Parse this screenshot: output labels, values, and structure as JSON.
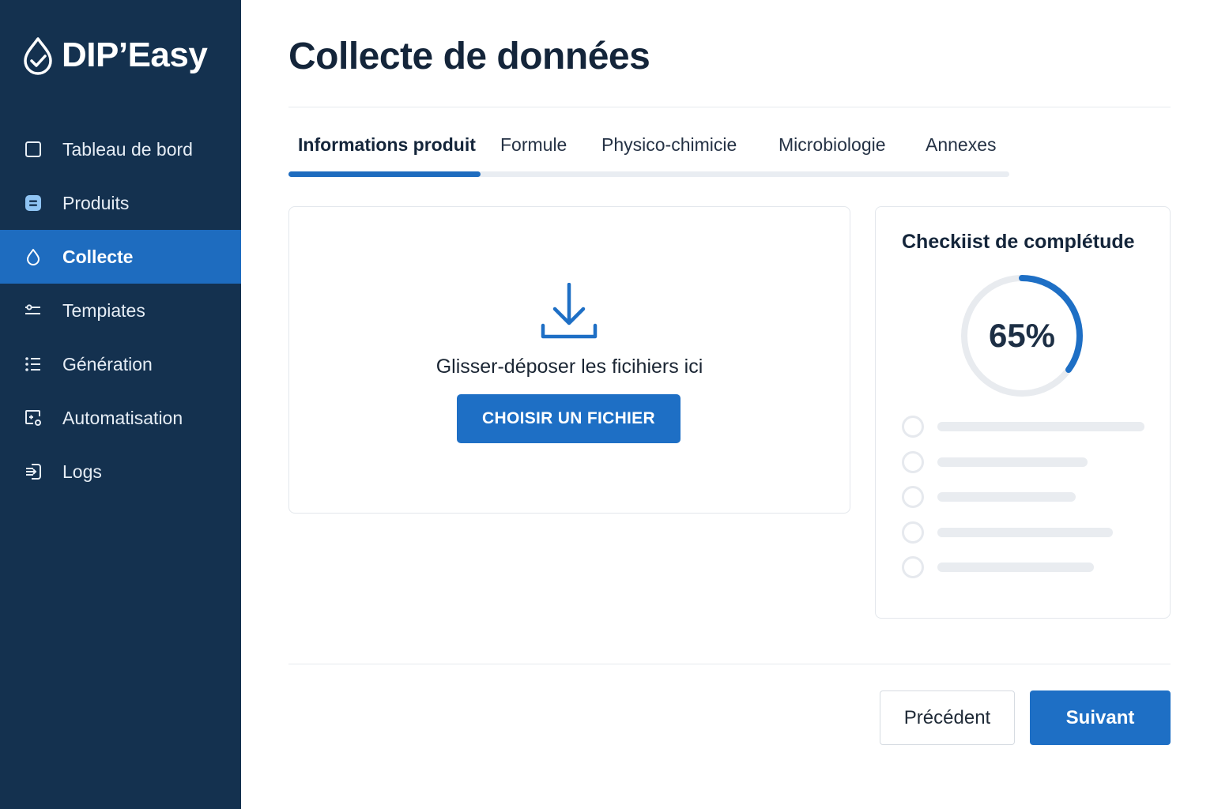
{
  "app": {
    "name": "DIP’Easy",
    "logo_icon": "drop-check-icon"
  },
  "sidebar": {
    "items": [
      {
        "label": "Tableau de bord",
        "icon": "square-icon",
        "active": false
      },
      {
        "label": "Produits",
        "icon": "list-box-icon",
        "active": false
      },
      {
        "label": "Collecte",
        "icon": "drop-icon",
        "active": true
      },
      {
        "label": "Tempiates",
        "icon": "sliders-icon",
        "active": false
      },
      {
        "label": "Génération",
        "icon": "checklist-icon",
        "active": false
      },
      {
        "label": "Automatisation",
        "icon": "automation-icon",
        "active": false
      },
      {
        "label": "Logs",
        "icon": "logs-icon",
        "active": false
      }
    ]
  },
  "page": {
    "title": "Collecte de données"
  },
  "tabs": [
    {
      "label": "Informations produit",
      "active": true
    },
    {
      "label": "Formule",
      "active": false
    },
    {
      "label": "Physico-chimicie",
      "active": false
    },
    {
      "label": "Microbiologie",
      "active": false
    },
    {
      "label": "Annexes",
      "active": false
    }
  ],
  "upload": {
    "icon": "download-icon",
    "text": "Glisser-déposer les ficihiers ici",
    "button_label": "CHOISIR UN FICHIER"
  },
  "checklist": {
    "title": "Checkiist de complétude",
    "progress_label": "65%",
    "progress_value": 0.35,
    "items_count_note": "5 placeholder items"
  },
  "footer": {
    "prev_label": "Précédent",
    "next_label": "Suivant"
  },
  "colors": {
    "sidebar_bg": "#14314f",
    "accent": "#1e6fc5",
    "active_nav": "#1e6cbf",
    "gauge_track": "#e8ebef"
  }
}
